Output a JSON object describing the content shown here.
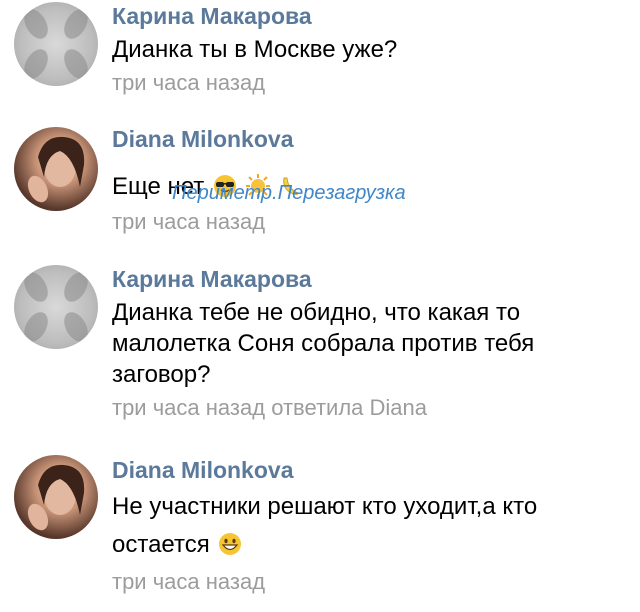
{
  "comments": [
    {
      "author": "Карина Макарова",
      "text": "Дианка ты в Москве уже?",
      "time": "три часа назад",
      "reply_note": ""
    },
    {
      "author": "Diana Milonkova",
      "text": "Еще нет",
      "emojis": [
        "sunglasses-face",
        "sun",
        "banana"
      ],
      "time": "три часа назад",
      "reply_note": ""
    },
    {
      "author": "Карина Макарова",
      "text": "Дианка тебе не обидно, что какая то малолетка Соня собрала против тебя заговор?",
      "time": "три часа назад",
      "reply_note": "ответила Diana"
    },
    {
      "author": "Diana Milonkova",
      "text": "Не участники решают кто уходит,а кто остается",
      "emojis": [
        "grinning-face"
      ],
      "time": "три часа назад",
      "reply_note": ""
    }
  ],
  "watermark": "Периметр.Перезагрузка",
  "colors": {
    "author": "#5b7a9b",
    "meta": "#9c9c9c",
    "watermark": "#3f87c8"
  }
}
